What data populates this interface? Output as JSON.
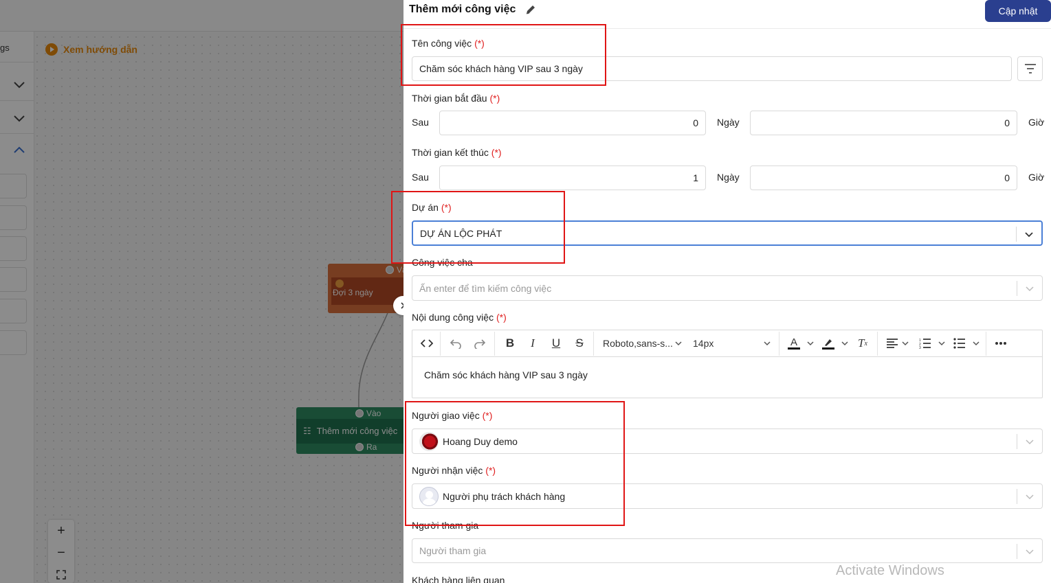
{
  "background": {
    "left_panel_label": "gs",
    "guide_link": "Xem hướng dẫn",
    "wait_node": {
      "input_label": "Và",
      "body": "Đợi 3 ngày"
    },
    "task_node": {
      "input_label": "Vào",
      "body": "Thêm mới công việc",
      "output_label": "Ra"
    },
    "zoom": {
      "in": "+",
      "out": "−"
    }
  },
  "drawer": {
    "title": "Thêm mới công việc",
    "update_button": "Cập nhật",
    "required_mark": "(*)",
    "task_name": {
      "label": "Tên công việc",
      "value": "Chăm sóc khách hàng VIP sau 3 ngày"
    },
    "start_time": {
      "label": "Thời gian bắt đầu",
      "prefix": "Sau",
      "days_value": "0",
      "days_unit": "Ngày",
      "hours_value": "0",
      "hours_unit": "Giờ"
    },
    "end_time": {
      "label": "Thời gian kết thúc",
      "prefix": "Sau",
      "days_value": "1",
      "days_unit": "Ngày",
      "hours_value": "0",
      "hours_unit": "Giờ"
    },
    "project": {
      "label": "Dự án",
      "value": "DỰ ÁN LỘC PHÁT"
    },
    "parent_task": {
      "label": "Công việc cha",
      "placeholder": "Ấn enter để tìm kiếm công việc"
    },
    "content": {
      "label": "Nội dung công việc",
      "toolbar": {
        "font_family": "Roboto,sans-s...",
        "font_size": "14px"
      },
      "text": "Chăm sóc khách hàng VIP sau 3 ngày"
    },
    "assigner": {
      "label": "Người giao việc",
      "value": "Hoang Duy demo"
    },
    "assignee": {
      "label": "Người nhận việc",
      "value": "Người phụ trách khách hàng"
    },
    "participants": {
      "label": "Người tham gia",
      "placeholder": "Người tham gia"
    },
    "related_customer": {
      "label": "Khách hàng liên quan"
    }
  },
  "watermark": "Activate Windows",
  "colors": {
    "primary": "#2a3f8f",
    "required": "#e02020",
    "annotation": "#e01414",
    "focus": "#4a7fd6"
  }
}
